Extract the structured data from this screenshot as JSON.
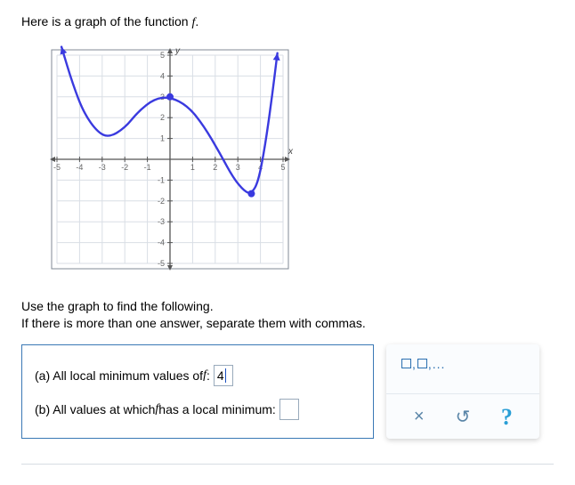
{
  "intro_prefix": "Here is a graph of the function ",
  "intro_fn": "f",
  "intro_suffix": ".",
  "instructions_l1": "Use the graph to find the following.",
  "instructions_l2": "If there is more than one answer, separate them with commas.",
  "qa": {
    "a_prefix": "(a) All local minimum values of ",
    "a_fn": "f",
    "a_suffix": ": ",
    "a_value": "4",
    "b_prefix": "(b) All values at which ",
    "b_fn": "f",
    "b_suffix": " has a local minimum: ",
    "b_value": ""
  },
  "tools": {
    "comma_hint": ",...",
    "clear": "×",
    "reset": "↺",
    "help": "?"
  },
  "chart_data": {
    "type": "line",
    "xlabel": "x",
    "ylabel": "y",
    "xlim": [
      -5,
      5
    ],
    "ylim": [
      -5,
      5
    ],
    "x_ticks": [
      -5,
      -4,
      -3,
      -2,
      -1,
      1,
      2,
      3,
      4,
      5
    ],
    "y_ticks": [
      -5,
      -4,
      -3,
      -2,
      -1,
      1,
      2,
      3,
      4,
      5
    ],
    "series": [
      {
        "name": "f",
        "points": [
          {
            "x": -4.8,
            "y": 5.4
          },
          {
            "x": -4.3,
            "y": 3.6
          },
          {
            "x": -3.8,
            "y": 2.2
          },
          {
            "x": -3.2,
            "y": 1.3
          },
          {
            "x": -2.7,
            "y": 1.05
          },
          {
            "x": -2.0,
            "y": 1.5
          },
          {
            "x": -1.4,
            "y": 2.3
          },
          {
            "x": -0.7,
            "y": 2.9
          },
          {
            "x": 0.0,
            "y": 3.0
          },
          {
            "x": 0.8,
            "y": 2.55
          },
          {
            "x": 1.5,
            "y": 1.6
          },
          {
            "x": 2.2,
            "y": 0.3
          },
          {
            "x": 2.8,
            "y": -0.9
          },
          {
            "x": 3.3,
            "y": -1.55
          },
          {
            "x": 3.6,
            "y": -1.65
          },
          {
            "x": 3.9,
            "y": -1.1
          },
          {
            "x": 4.2,
            "y": 0.6
          },
          {
            "x": 4.5,
            "y": 2.9
          },
          {
            "x": 4.75,
            "y": 5.1
          }
        ]
      }
    ],
    "markers": [
      {
        "x": 0,
        "y": 3
      },
      {
        "x": 3.6,
        "y": -1.65
      }
    ],
    "arrows_at_ends": true
  }
}
